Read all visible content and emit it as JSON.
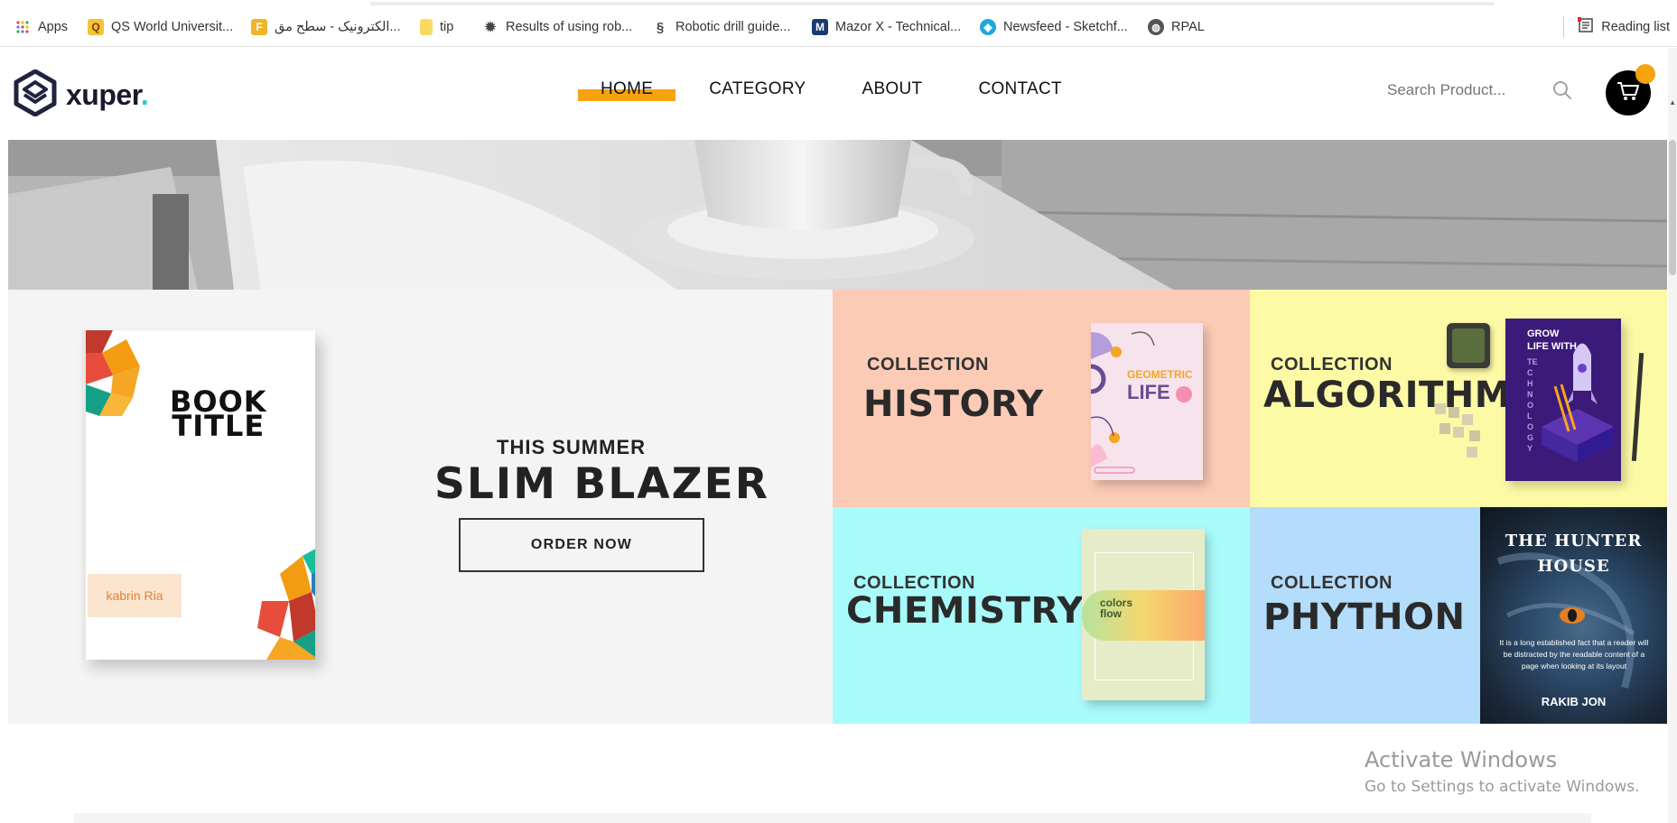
{
  "bookmarks": {
    "items": [
      {
        "label": "Apps",
        "icon": "apps-grid-icon"
      },
      {
        "label": "QS World Universit...",
        "icon": "qs-icon"
      },
      {
        "label": "الکترونیک - سطح مق...",
        "icon": "bookmark-folder-icon"
      },
      {
        "label": "tip",
        "icon": "folder-icon"
      },
      {
        "label": "Results of using rob...",
        "icon": "gear-bug-icon"
      },
      {
        "label": "Robotic drill guide...",
        "icon": "link-icon"
      },
      {
        "label": "Mazor X - Technical...",
        "icon": "mazor-icon"
      },
      {
        "label": "Newsfeed - Sketchf...",
        "icon": "sketchfab-icon"
      },
      {
        "label": "RPAL",
        "icon": "globe-icon"
      }
    ],
    "reading_list": "Reading list"
  },
  "header": {
    "logo_text": "xuper",
    "logo_dot": ".",
    "nav": [
      {
        "label": "HOME",
        "active": true
      },
      {
        "label": "CATEGORY",
        "active": false
      },
      {
        "label": "ABOUT",
        "active": false
      },
      {
        "label": "CONTACT",
        "active": false
      }
    ],
    "search_placeholder": "Search Product...",
    "accent_color": "#f7a20f"
  },
  "promo": {
    "book_title_line1": "BOOK",
    "book_title_line2": "TITLE",
    "book_author": "kabrin Ria",
    "kicker": "THIS SUMMER",
    "headline": "SLIM BLAZER",
    "cta": "ORDER NOW"
  },
  "collections": [
    {
      "kicker": "COLLECTION",
      "name": "HISTORY",
      "color": "#fccbb6",
      "cover_text": "GEOMETRIC",
      "cover_text2": "LIFE"
    },
    {
      "kicker": "COLLECTION",
      "name": "ALGORITHMS",
      "color": "#fdfaa6",
      "cover_text": "GROW",
      "cover_text2": "LIFE WITH",
      "cover_text3": "TECHNOLOGY"
    },
    {
      "kicker": "COLLECTION",
      "name": "CHEMISTRY",
      "color": "#a9fbfb",
      "cover_text": "colors",
      "cover_text2": "flow"
    },
    {
      "kicker": "COLLECTION",
      "name": "PHYTHON",
      "color": "#b4dcfb",
      "cover_text": "THE HUNTER",
      "cover_text2": "HOUSE",
      "cover_author": "RAKIB JON",
      "cover_blurb": "It is a long established fact that a reader will be distracted by the readable content of a page when looking at its layout"
    }
  ],
  "watermark": {
    "line1": "Activate Windows",
    "line2": "Go to Settings to activate Windows."
  }
}
